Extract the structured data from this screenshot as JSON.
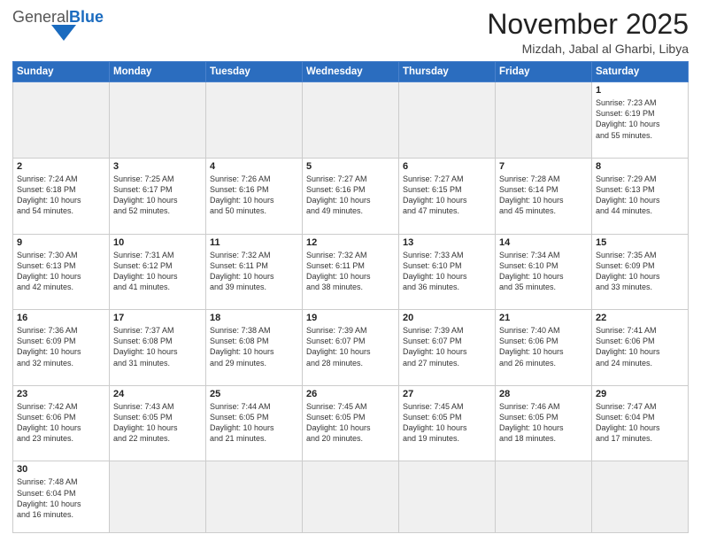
{
  "header": {
    "logo_general": "General",
    "logo_blue": "Blue",
    "month_title": "November 2025",
    "location": "Mizdah, Jabal al Gharbi, Libya"
  },
  "days_of_week": [
    "Sunday",
    "Monday",
    "Tuesday",
    "Wednesday",
    "Thursday",
    "Friday",
    "Saturday"
  ],
  "weeks": [
    [
      {
        "date": "",
        "info": ""
      },
      {
        "date": "",
        "info": ""
      },
      {
        "date": "",
        "info": ""
      },
      {
        "date": "",
        "info": ""
      },
      {
        "date": "",
        "info": ""
      },
      {
        "date": "",
        "info": ""
      },
      {
        "date": "1",
        "info": "Sunrise: 7:23 AM\nSunset: 6:19 PM\nDaylight: 10 hours\nand 55 minutes."
      }
    ],
    [
      {
        "date": "2",
        "info": "Sunrise: 7:24 AM\nSunset: 6:18 PM\nDaylight: 10 hours\nand 54 minutes."
      },
      {
        "date": "3",
        "info": "Sunrise: 7:25 AM\nSunset: 6:17 PM\nDaylight: 10 hours\nand 52 minutes."
      },
      {
        "date": "4",
        "info": "Sunrise: 7:26 AM\nSunset: 6:16 PM\nDaylight: 10 hours\nand 50 minutes."
      },
      {
        "date": "5",
        "info": "Sunrise: 7:27 AM\nSunset: 6:16 PM\nDaylight: 10 hours\nand 49 minutes."
      },
      {
        "date": "6",
        "info": "Sunrise: 7:27 AM\nSunset: 6:15 PM\nDaylight: 10 hours\nand 47 minutes."
      },
      {
        "date": "7",
        "info": "Sunrise: 7:28 AM\nSunset: 6:14 PM\nDaylight: 10 hours\nand 45 minutes."
      },
      {
        "date": "8",
        "info": "Sunrise: 7:29 AM\nSunset: 6:13 PM\nDaylight: 10 hours\nand 44 minutes."
      }
    ],
    [
      {
        "date": "9",
        "info": "Sunrise: 7:30 AM\nSunset: 6:13 PM\nDaylight: 10 hours\nand 42 minutes."
      },
      {
        "date": "10",
        "info": "Sunrise: 7:31 AM\nSunset: 6:12 PM\nDaylight: 10 hours\nand 41 minutes."
      },
      {
        "date": "11",
        "info": "Sunrise: 7:32 AM\nSunset: 6:11 PM\nDaylight: 10 hours\nand 39 minutes."
      },
      {
        "date": "12",
        "info": "Sunrise: 7:32 AM\nSunset: 6:11 PM\nDaylight: 10 hours\nand 38 minutes."
      },
      {
        "date": "13",
        "info": "Sunrise: 7:33 AM\nSunset: 6:10 PM\nDaylight: 10 hours\nand 36 minutes."
      },
      {
        "date": "14",
        "info": "Sunrise: 7:34 AM\nSunset: 6:10 PM\nDaylight: 10 hours\nand 35 minutes."
      },
      {
        "date": "15",
        "info": "Sunrise: 7:35 AM\nSunset: 6:09 PM\nDaylight: 10 hours\nand 33 minutes."
      }
    ],
    [
      {
        "date": "16",
        "info": "Sunrise: 7:36 AM\nSunset: 6:09 PM\nDaylight: 10 hours\nand 32 minutes."
      },
      {
        "date": "17",
        "info": "Sunrise: 7:37 AM\nSunset: 6:08 PM\nDaylight: 10 hours\nand 31 minutes."
      },
      {
        "date": "18",
        "info": "Sunrise: 7:38 AM\nSunset: 6:08 PM\nDaylight: 10 hours\nand 29 minutes."
      },
      {
        "date": "19",
        "info": "Sunrise: 7:39 AM\nSunset: 6:07 PM\nDaylight: 10 hours\nand 28 minutes."
      },
      {
        "date": "20",
        "info": "Sunrise: 7:39 AM\nSunset: 6:07 PM\nDaylight: 10 hours\nand 27 minutes."
      },
      {
        "date": "21",
        "info": "Sunrise: 7:40 AM\nSunset: 6:06 PM\nDaylight: 10 hours\nand 26 minutes."
      },
      {
        "date": "22",
        "info": "Sunrise: 7:41 AM\nSunset: 6:06 PM\nDaylight: 10 hours\nand 24 minutes."
      }
    ],
    [
      {
        "date": "23",
        "info": "Sunrise: 7:42 AM\nSunset: 6:06 PM\nDaylight: 10 hours\nand 23 minutes."
      },
      {
        "date": "24",
        "info": "Sunrise: 7:43 AM\nSunset: 6:05 PM\nDaylight: 10 hours\nand 22 minutes."
      },
      {
        "date": "25",
        "info": "Sunrise: 7:44 AM\nSunset: 6:05 PM\nDaylight: 10 hours\nand 21 minutes."
      },
      {
        "date": "26",
        "info": "Sunrise: 7:45 AM\nSunset: 6:05 PM\nDaylight: 10 hours\nand 20 minutes."
      },
      {
        "date": "27",
        "info": "Sunrise: 7:45 AM\nSunset: 6:05 PM\nDaylight: 10 hours\nand 19 minutes."
      },
      {
        "date": "28",
        "info": "Sunrise: 7:46 AM\nSunset: 6:05 PM\nDaylight: 10 hours\nand 18 minutes."
      },
      {
        "date": "29",
        "info": "Sunrise: 7:47 AM\nSunset: 6:04 PM\nDaylight: 10 hours\nand 17 minutes."
      }
    ],
    [
      {
        "date": "30",
        "info": "Sunrise: 7:48 AM\nSunset: 6:04 PM\nDaylight: 10 hours\nand 16 minutes."
      },
      {
        "date": "",
        "info": ""
      },
      {
        "date": "",
        "info": ""
      },
      {
        "date": "",
        "info": ""
      },
      {
        "date": "",
        "info": ""
      },
      {
        "date": "",
        "info": ""
      },
      {
        "date": "",
        "info": ""
      }
    ]
  ]
}
